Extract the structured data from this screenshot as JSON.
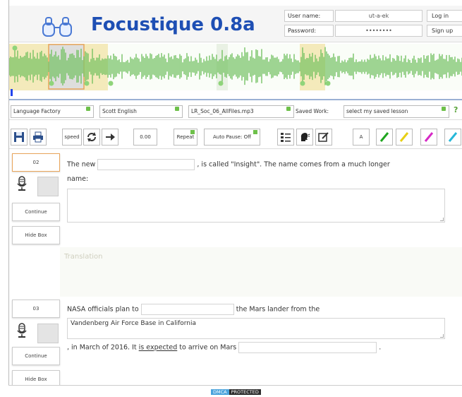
{
  "header": {
    "title": "Focustique 0.8a",
    "user_name_label": "User name:",
    "user_name_value": "ut-a-ek",
    "password_label": "Password:",
    "password_value": "••••••••",
    "login_label": "Log in",
    "signup_label": "Sign up"
  },
  "settings": {
    "language_factory": "Language Factory",
    "voice": "Scott English",
    "file": "LR_Soc_06_AllFiles.mp3",
    "saved_work_label": "Saved Work:",
    "saved_work_value": "select my saved lesson",
    "help": "?"
  },
  "toolbar": {
    "speed_label": "speed",
    "zoom_value": "0.00",
    "mode_label": "Repeat",
    "auto_pause_label": "Auto Pause: Off",
    "record_label": "A"
  },
  "colors": {
    "brand": "#1e4fb4",
    "wave": "#6cbf5a",
    "selection": "#f2e6b0",
    "active_border": "#e9a55a"
  },
  "sentences": [
    {
      "number": "02",
      "play_label": "Continue",
      "next_label": "Hide Box",
      "text_before": "The new",
      "text_after": ", is called \"Insight\". The name comes from a much longer",
      "line2": "name:",
      "answer": ""
    },
    {
      "number": "03",
      "play_label": "Continue",
      "next_label": "Hide Box",
      "text_before": "NASA officials plan to",
      "text_after": "the Mars lander from the",
      "answer": "Vandenberg Air Force Base in California",
      "line3_before": ", in March of 2016. It",
      "line3_link": "is expected",
      "line3_after": "to arrive on Mars",
      "line3_end": "."
    }
  ],
  "translation_label": "Translation",
  "footer": {
    "badge_left": "DMCA",
    "badge_right": "PROTECTED"
  }
}
